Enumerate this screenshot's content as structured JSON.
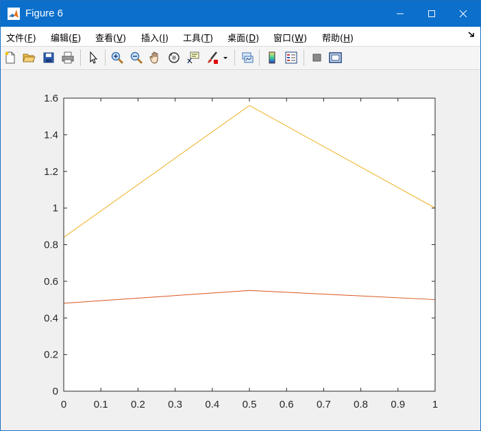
{
  "window": {
    "title": "Figure 6",
    "controls": [
      "minimize",
      "maximize",
      "close"
    ]
  },
  "menubar": {
    "items": [
      {
        "label": "文件(",
        "key": "F",
        "suffix": ")"
      },
      {
        "label": "编辑(",
        "key": "E",
        "suffix": ")"
      },
      {
        "label": "查看(",
        "key": "V",
        "suffix": ")"
      },
      {
        "label": "插入(",
        "key": "I",
        "suffix": ")"
      },
      {
        "label": "工具(",
        "key": "T",
        "suffix": ")"
      },
      {
        "label": "桌面(",
        "key": "D",
        "suffix": ")"
      },
      {
        "label": "窗口(",
        "key": "W",
        "suffix": ")"
      },
      {
        "label": "帮助(",
        "key": "H",
        "suffix": ")"
      }
    ],
    "overflow_icon": "dock-arrow-icon"
  },
  "toolbar": {
    "icons": [
      "new-figure-icon",
      "open-file-icon",
      "save-icon",
      "print-icon",
      "pointer-icon",
      "zoom-in-icon",
      "zoom-out-icon",
      "pan-icon",
      "rotate-3d-icon",
      "data-cursor-icon",
      "brush-icon",
      "link-plot-icon",
      "colorbar-icon",
      "legend-icon",
      "hide-plot-tools-icon",
      "show-plot-tools-icon"
    ]
  },
  "chart_data": {
    "type": "line",
    "title": "",
    "xlabel": "",
    "ylabel": "",
    "xlim": [
      0,
      1
    ],
    "ylim": [
      0,
      1.6
    ],
    "xticks": [
      "0",
      "0.1",
      "0.2",
      "0.3",
      "0.4",
      "0.5",
      "0.6",
      "0.7",
      "0.8",
      "0.9",
      "1"
    ],
    "yticks": [
      "0",
      "0.2",
      "0.4",
      "0.6",
      "0.8",
      "1",
      "1.2",
      "1.4",
      "1.6"
    ],
    "grid": false,
    "series": [
      {
        "x": [
          0,
          0.5,
          1
        ],
        "values": [
          0,
          0,
          0
        ],
        "color": "#0072BD"
      },
      {
        "x": [
          0,
          0.5,
          1
        ],
        "values": [
          0.48,
          0.55,
          0.5
        ],
        "color": "#D95319"
      },
      {
        "x": [
          0,
          0.5,
          1
        ],
        "values": [
          0.84,
          1.56,
          1.0
        ],
        "color": "#EDB120"
      }
    ]
  }
}
